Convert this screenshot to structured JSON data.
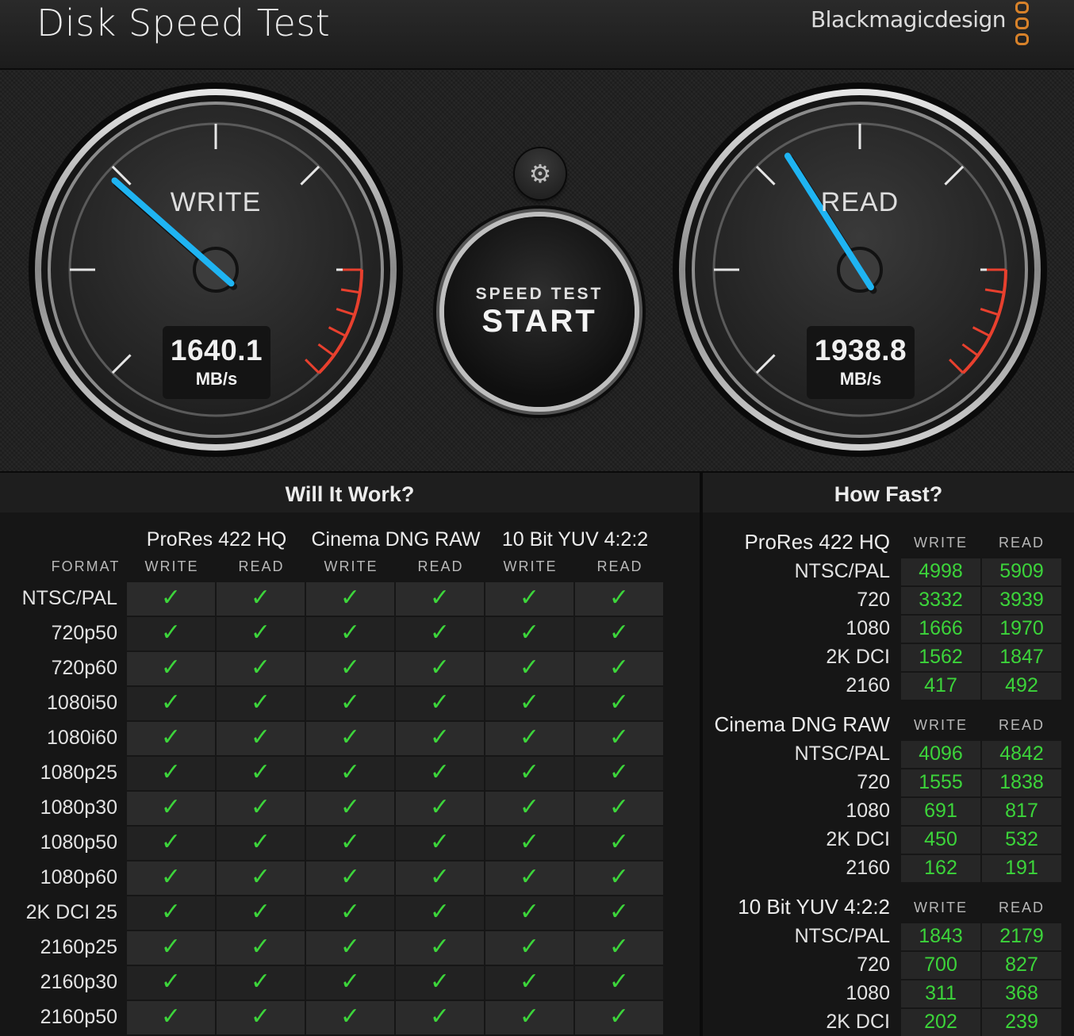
{
  "app": {
    "title": "Disk Speed Test",
    "brand": "Blackmagicdesign"
  },
  "gauges": {
    "write": {
      "label": "WRITE",
      "value": "1640.1",
      "unit": "MB/s",
      "needle_fraction": 0.32
    },
    "read": {
      "label": "READ",
      "value": "1938.8",
      "unit": "MB/s",
      "needle_fraction": 0.38
    }
  },
  "controls": {
    "settings_icon": "gear-icon",
    "start_small": "SPEED TEST",
    "start_big": "START"
  },
  "colors": {
    "needle": "#1fb4f2",
    "redline": "#e8402e",
    "check": "#3dd53b",
    "value_green": "#3cd43a",
    "brand_logo": "#d8822a"
  },
  "will_it_work": {
    "title": "Will It Work?",
    "format_label": "FORMAT",
    "groups": [
      {
        "name": "ProRes 422 HQ",
        "write": "WRITE",
        "read": "READ"
      },
      {
        "name": "Cinema DNG RAW",
        "write": "WRITE",
        "read": "READ"
      },
      {
        "name": "10 Bit YUV 4:2:2",
        "write": "WRITE",
        "read": "READ"
      }
    ],
    "formats": [
      "NTSC/PAL",
      "720p50",
      "720p60",
      "1080i50",
      "1080i60",
      "1080p25",
      "1080p30",
      "1080p50",
      "1080p60",
      "2K DCI 25",
      "2160p25",
      "2160p30",
      "2160p50"
    ],
    "check_glyph": "✓"
  },
  "how_fast": {
    "title": "How Fast?",
    "groups": [
      {
        "name": "ProRes 422 HQ",
        "write": "WRITE",
        "read": "READ",
        "rows": [
          {
            "label": "NTSC/PAL",
            "write": "4998",
            "read": "5909"
          },
          {
            "label": "720",
            "write": "3332",
            "read": "3939"
          },
          {
            "label": "1080",
            "write": "1666",
            "read": "1970"
          },
          {
            "label": "2K DCI",
            "write": "1562",
            "read": "1847"
          },
          {
            "label": "2160",
            "write": "417",
            "read": "492"
          }
        ]
      },
      {
        "name": "Cinema DNG RAW",
        "write": "WRITE",
        "read": "READ",
        "rows": [
          {
            "label": "NTSC/PAL",
            "write": "4096",
            "read": "4842"
          },
          {
            "label": "720",
            "write": "1555",
            "read": "1838"
          },
          {
            "label": "1080",
            "write": "691",
            "read": "817"
          },
          {
            "label": "2K DCI",
            "write": "450",
            "read": "532"
          },
          {
            "label": "2160",
            "write": "162",
            "read": "191"
          }
        ]
      },
      {
        "name": "10 Bit YUV 4:2:2",
        "write": "WRITE",
        "read": "READ",
        "rows": [
          {
            "label": "NTSC/PAL",
            "write": "1843",
            "read": "2179"
          },
          {
            "label": "720",
            "write": "700",
            "read": "827"
          },
          {
            "label": "1080",
            "write": "311",
            "read": "368"
          },
          {
            "label": "2K DCI",
            "write": "202",
            "read": "239"
          }
        ]
      }
    ]
  }
}
